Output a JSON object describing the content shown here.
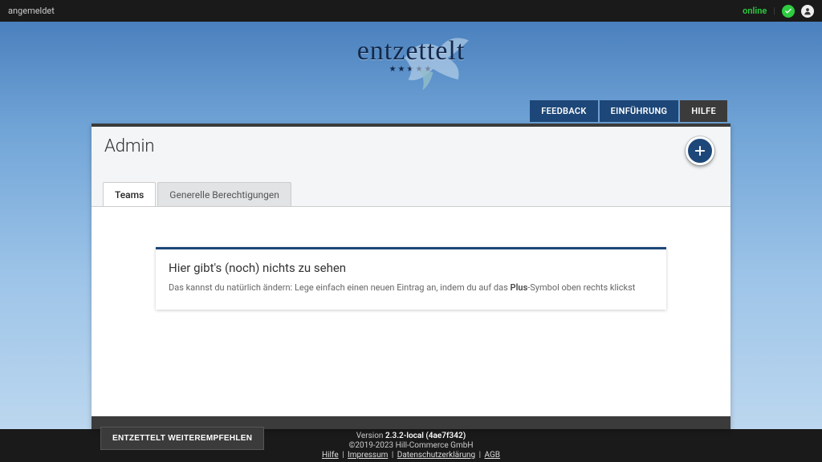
{
  "topbar": {
    "login_state": "angemeldet",
    "online_label": "online"
  },
  "brand": {
    "name": "entzettelt",
    "stars": "★★★★★"
  },
  "nav": {
    "feedback": "FEEDBACK",
    "intro": "EINFÜHRUNG",
    "help": "HILFE"
  },
  "page": {
    "title": "Admin"
  },
  "tabs": {
    "teams": "Teams",
    "permissions": "Generelle Berechtigungen"
  },
  "empty": {
    "title": "Hier gibt's (noch) nichts zu sehen",
    "body_prefix": "Das kannst du natürlich ändern: Lege einfach einen neuen Eintrag an, indem du auf das ",
    "body_bold": "Plus",
    "body_suffix": "-Symbol oben rechts klickst"
  },
  "recommend": {
    "label": "ENTZETTELT WEITEREMPFEHLEN"
  },
  "footer": {
    "version_label": "Version ",
    "version_value": "2.3.2-local (4ae7f342)",
    "copyright": "©2019-2023 Hill-Commerce GmbH",
    "links": {
      "help": "Hilfe",
      "imprint": "Impressum",
      "privacy": "Datenschutzerklärung",
      "terms": "AGB"
    }
  }
}
